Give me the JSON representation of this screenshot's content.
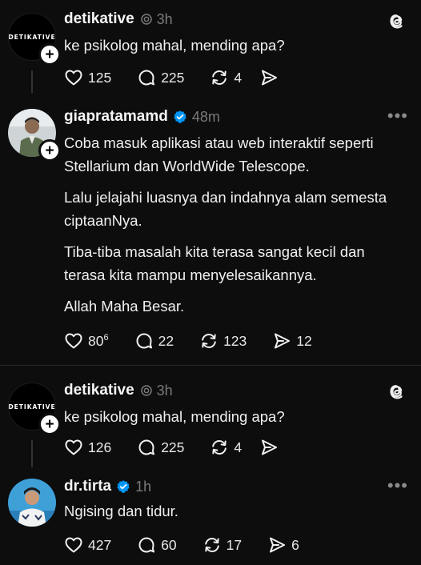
{
  "posts": [
    {
      "username": "detikative",
      "avatar_text": "DETIKATIVE",
      "time": "3h",
      "text": [
        "ke psikolog mahal, mending apa?"
      ],
      "likes": "125",
      "replies": "225",
      "reposts": "4",
      "shares": ""
    },
    {
      "username": "giapratamamd",
      "time": "48m",
      "text": [
        "Coba masuk aplikasi atau web interaktif seperti Stellarium dan WorldWide Telescope.",
        "Lalu jelajahi luasnya dan indahnya alam semesta ciptaanNya.",
        "Tiba-tiba masalah kita terasa sangat kecil dan terasa kita mampu menyelesaikannya.",
        "Allah Maha Besar."
      ],
      "likes": "80",
      "likes_sup": "6",
      "replies": "22",
      "reposts": "123",
      "shares": "12"
    },
    {
      "username": "detikative",
      "avatar_text": "DETIKATIVE",
      "time": "3h",
      "text": [
        "ke psikolog mahal, mending apa?"
      ],
      "likes": "126",
      "replies": "225",
      "reposts": "4",
      "shares": ""
    },
    {
      "username": "dr.tirta",
      "time": "1h",
      "text": [
        "Ngising dan tidur."
      ],
      "likes": "427",
      "replies": "60",
      "reposts": "17",
      "shares": "6"
    }
  ],
  "icons": {
    "threads": "threads-logo-icon",
    "verified": "verified-badge-icon",
    "more": "more-options-icon",
    "like": "heart-icon",
    "reply": "reply-icon",
    "repost": "repost-icon",
    "share": "share-icon"
  },
  "colors": {
    "background": "#0d0d0d",
    "verified": "#0095f6",
    "muted": "#7a7a7a"
  }
}
